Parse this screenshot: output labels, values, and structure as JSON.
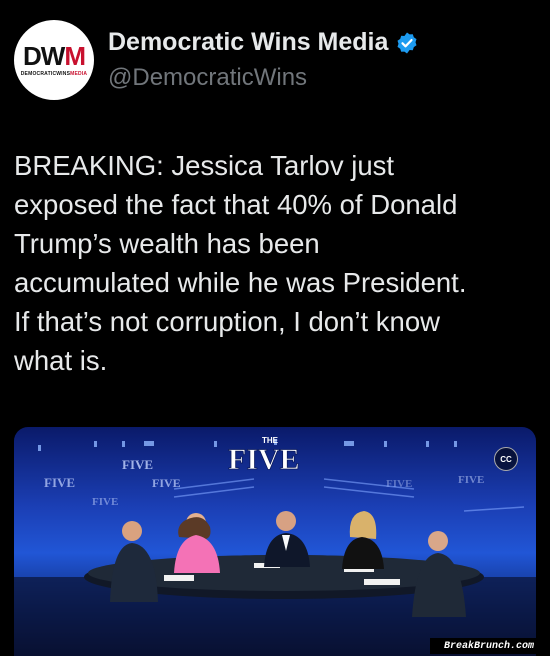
{
  "account": {
    "avatar_text_main": "DW",
    "avatar_text_accent": "M",
    "avatar_subtext_main": "DEMOCRATICWINS",
    "avatar_subtext_accent": "MEDIA",
    "display_name": "Democratic Wins Media",
    "handle": "@DemocraticWins",
    "verified_icon": "verified-badge-icon",
    "verified_color": "#1d9bf0"
  },
  "tweet": {
    "text": "BREAKING: Jessica Tarlov just\nexposed the fact that 40% of Donald\nTrump’s wealth has been\naccumulated while he was President.\nIf that’s not corruption, I don’t know\nwhat is."
  },
  "media": {
    "show_logo_small": "THE",
    "show_logo_large": "FIVE",
    "cc_label": "CC"
  },
  "watermark": "BreakBrunch.com"
}
